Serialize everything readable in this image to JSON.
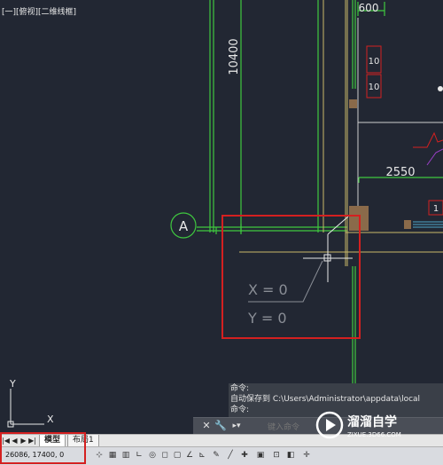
{
  "viewport": {
    "label": "[一][俯视][二维线框]"
  },
  "drawing": {
    "dim_top": "600",
    "dim_vertical": "10400",
    "dim_horizontal": "2550",
    "tag_1": "10",
    "tag_2": "10",
    "tag_3": "1",
    "axis_bubble": "A",
    "ucs_x": "X",
    "ucs_y": "Y"
  },
  "cursor_tooltip": {
    "x_readout": "X = 0",
    "y_readout": "Y = 0"
  },
  "command": {
    "history_1": "命令:",
    "history_2": "自动保存到 C:\\Users\\Administrator\\appdata\\local",
    "history_3": "命令:",
    "placeholder": "键入命令"
  },
  "tabs": {
    "model": "模型",
    "layout1": "布局1"
  },
  "status": {
    "coords": "26086,  17400,  0"
  },
  "watermark": {
    "title": "溜溜自学",
    "url": "ZIXUE.3D66.COM"
  },
  "colors": {
    "background": "#222733",
    "green_lines": "#3fc83f",
    "yellow_lines": "#c9b86a",
    "dimension_text": "#e8e8e8",
    "highlight_red": "#d42020"
  }
}
